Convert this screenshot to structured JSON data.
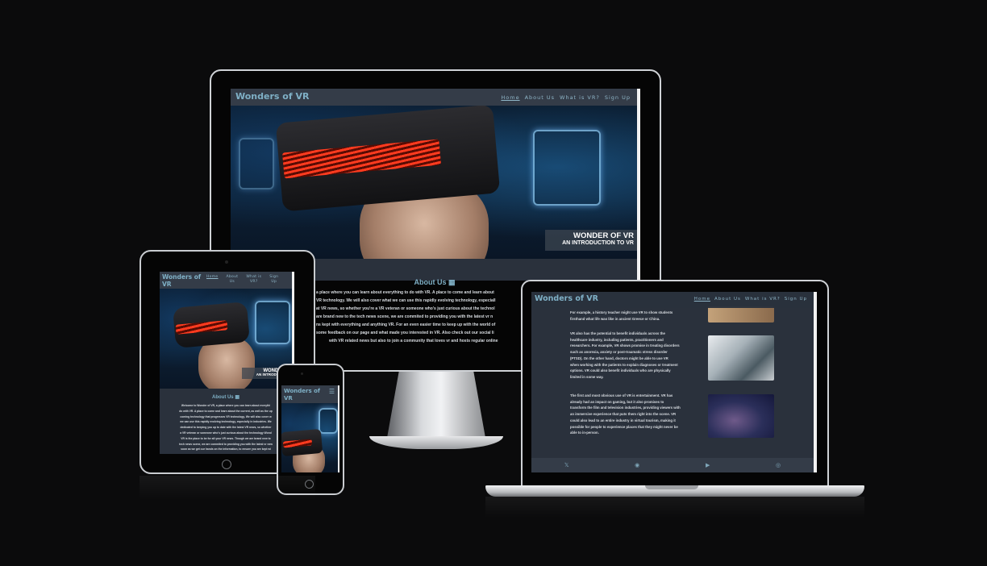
{
  "site": {
    "brand": "Wonders of VR",
    "brand_tablet_line1": "Wonders of",
    "brand_tablet_line2": "VR",
    "nav": [
      "Home",
      "About Us",
      "What is VR?",
      "Sign Up"
    ],
    "nav_tablet": [
      [
        "Home",
        ""
      ],
      [
        "About",
        "Us"
      ],
      [
        "What is",
        "VR?"
      ],
      [
        "Sign",
        "Up"
      ]
    ],
    "menu_icon": "hamburger-icon"
  },
  "hero": {
    "caption_title": "WONDER OF VR",
    "caption_subtitle": "AN INTRODUCTION TO VR",
    "caption_title_tablet": "WONDER O",
    "caption_subtitle_tablet": "AN INTRODUCTION"
  },
  "about": {
    "heading": "About Us",
    "heading_icon": "vr-headset-icon",
    "imac_lines": [
      "a place where you can learn about everything to do with VR. A place to come and learn about",
      "VR technology. We will also cover what we can use this rapidly evolving technology, especiall",
      "at VR news, so whether you're a VR veteran or someone who's just curious about the technol",
      "are brand new to the tech news scene, we are commited to providing you with the latest vr n",
      "ns kept with everything and anything VR. For an even easier time to keep up with the world of",
      "some feedback on our page and what made you interested in VR. Also check out our social li",
      "with VR related news but also to join a community that loves vr and hosts regular online"
    ],
    "tablet_lines": [
      "Welcome to Wonder of VR, a place where you can learn about everythi",
      "do with VR. A place to come and learn about the current, as well as the up",
      "coming technology that progresses VR technology. We will also cover w",
      "we can use this rapidly evolving technology, especially in industries. We",
      "dedicated to keeping you up to date with the latest VR news, so whether",
      "a VR veteran or someone who's just curious about the technology Wond",
      "VR is the place to be for all your VR news. Though we are brand new to",
      "tech news scene, we are commited to providing you with the latest vr new",
      "soon as we get our hands on the information, to ensure you are kept wi"
    ]
  },
  "laptop": {
    "para1": [
      "For example, a history teacher might use VR to show students",
      "firsthand what life was like in ancient Greece or China."
    ],
    "para2": [
      "VR also has the potential to benefit individuals across the",
      "healthcare industry, including patients, practitioners and",
      "researchers. For example, VR shows promise in treating disorders",
      "such as anorexia, anxiety or post-traumatic stress disorder",
      "(PTSD). On the other hand, doctors might be able to use VR",
      "when working with the patients to explain diagnoses or treatment",
      "options. VR could also benefit individuals who are physically",
      "limited in some way."
    ],
    "para3": [
      "The first and most obvious use of VR is entertainment. VR has",
      "already had an impact on gaming, but it also promises to",
      "transform the film and television industries, providing viewers with",
      "an immersive experience that puts them right into the scene. VR",
      "could also lead to an entire industry in virtual tourism, making it",
      "possible for people to experience places that they might never be",
      "able to in-person."
    ],
    "social": [
      "x-icon",
      "discord-icon",
      "youtube-icon",
      "instagram-icon"
    ],
    "social_glyphs": [
      "𝕏",
      "◉",
      "▶",
      "◎"
    ]
  }
}
